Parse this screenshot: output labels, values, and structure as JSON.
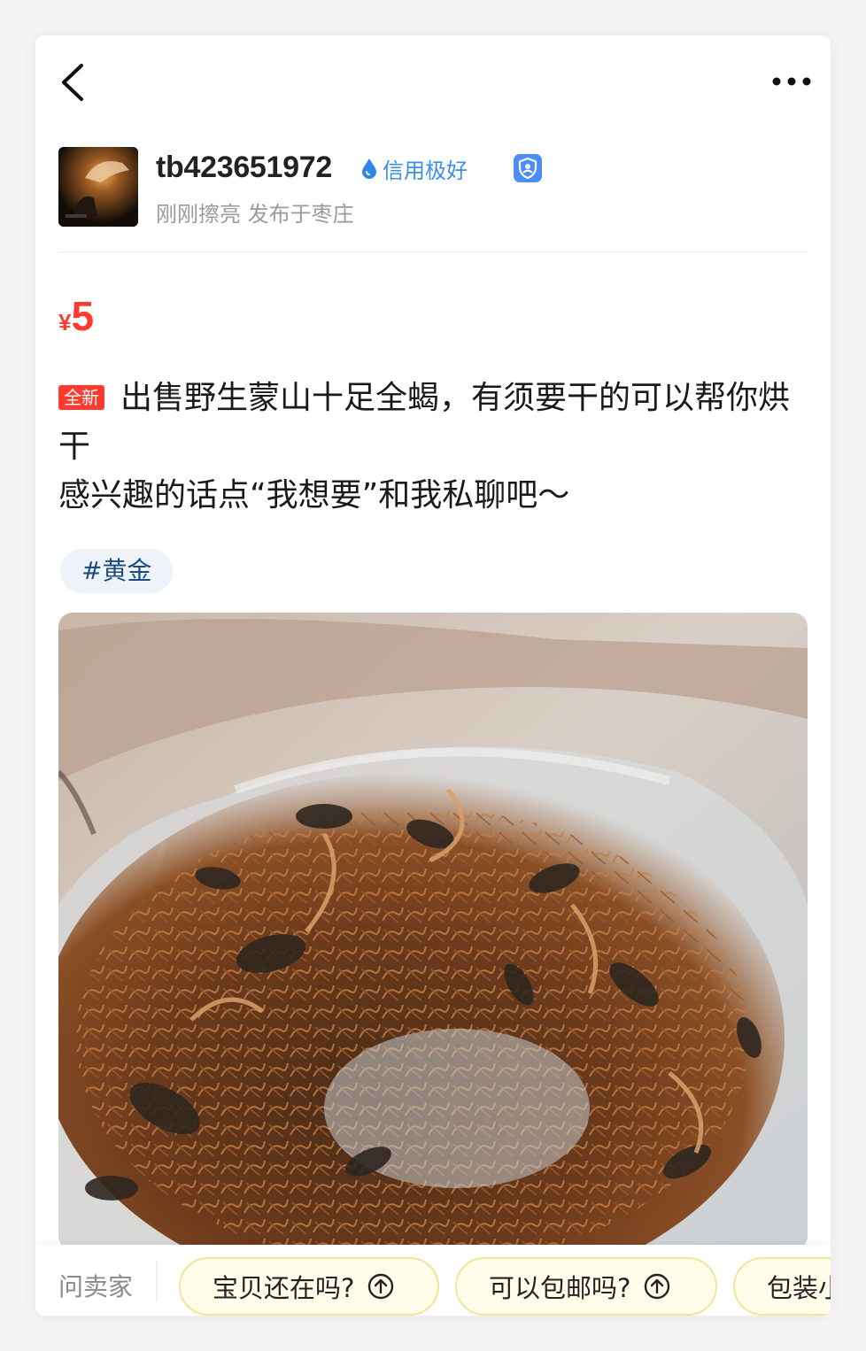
{
  "header": {
    "back_icon": "chevron-left-icon",
    "more_icon": "more-horizontal-icon"
  },
  "seller": {
    "username": "tb423651972",
    "credit_label": "信用极好",
    "credit_icon": "water-drop-icon",
    "verified_icon": "verified-user-icon",
    "meta": "刚刚擦亮 发布于枣庄"
  },
  "listing": {
    "currency": "¥",
    "price": "5",
    "condition_badge": "全新",
    "title_line1": "出售野生蒙山十足全蝎，有须要干的可以帮你烘干",
    "title_line2": "感兴趣的话点“我想要”和我私聊吧～",
    "tag": "#黄金",
    "price_color": "#ff3b30"
  },
  "ask_bar": {
    "label": "问卖家",
    "questions": [
      {
        "text": "宝贝还在吗?"
      },
      {
        "text": "可以包邮吗?"
      },
      {
        "text": "包装小"
      }
    ]
  }
}
